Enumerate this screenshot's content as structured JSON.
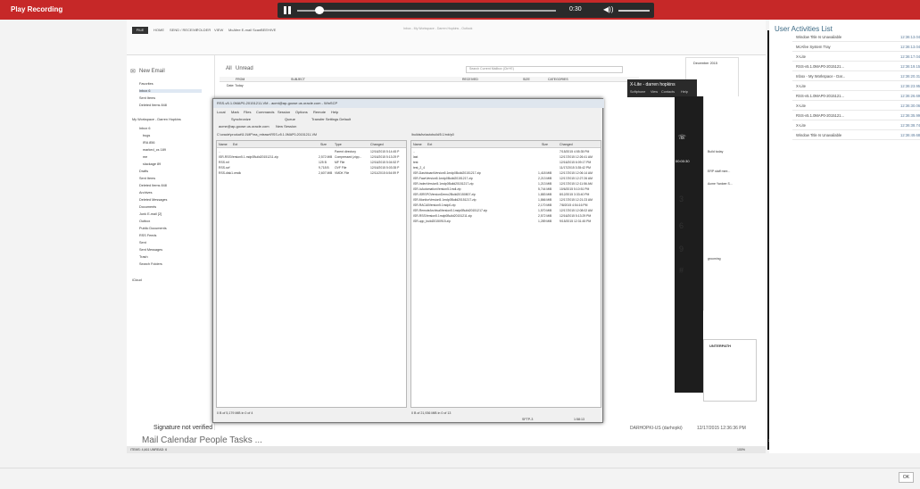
{
  "recording": {
    "title": "Play Recording",
    "time": "0:30",
    "progress": 0.04
  },
  "outlook": {
    "tabs": [
      "FILE",
      "HOME",
      "SEND / RECEIVE",
      "FOLDER",
      "VIEW",
      "McAfee E-mail Scan",
      "BEEHIVE"
    ],
    "title": "Inbox - My Workspace - Darren Hopkins - Outlook",
    "new_email": "New Email",
    "filter_all": "All",
    "filter_unread": "Unread",
    "search_placeholder": "Search Current Mailbox (Ctrl+E)",
    "folders": [
      "Favorites",
      "Inbox 6",
      "Sent Items",
      "Deleted Items 848",
      "My Workspace - Darren Hopkins",
      "Inbox 6",
      "bugs",
      "IRA 856",
      "marked_cs 189",
      "me",
      "slackage 89",
      "Drafts",
      "Sent Items",
      "Deleted Items 848",
      "Archives",
      "Deleted Messages",
      "Documents",
      "Junk E-mail [2]",
      "Outbox",
      "Public Documents",
      "RSS Feeds",
      "Sent",
      "Sent Messages",
      "Trash",
      "Search Folders",
      "iCloud"
    ],
    "columns": [
      "FROM",
      "SUBJECT",
      "RECEIVED",
      "SIZE",
      "CATEGORIES"
    ],
    "date_group": "Date: Today",
    "signature": "Signature not verified",
    "nav": [
      "Mail",
      "Calendar",
      "People",
      "Tasks",
      "..."
    ],
    "status": "ITEMS: 4,461   UNREAD: 6",
    "zoom": "100%"
  },
  "winscp": {
    "title": "RSS-v5.1.0MAP0-20151211-VM - acmt@ap-goose.us.oracle.com - WinSCP",
    "menu": [
      "Local",
      "Mark",
      "Files",
      "Commands",
      "Session",
      "Options",
      "Remote",
      "Help"
    ],
    "toolbar": [
      "Synchronize",
      "Queue",
      "Transfer Settings Default"
    ],
    "session_tab": "acme@ap-goose.us.oracle.com",
    "new_session": "New Session",
    "left": {
      "drive": "C: System",
      "path": "C:\\oracle\\product\\5.1\\MP\\rss_release\\RSS-v5.1.0MAP0-20151211-VM",
      "headers": [
        "Name",
        "Ext",
        "Size",
        "Type",
        "Changed"
      ],
      "rows": [
        {
          "name": "..",
          "size": "",
          "type": "Parent directory",
          "changed": "12/16/2015 5:14:45 P"
        },
        {
          "name": "ISR-RSSVersion5.1.mdp0Build20151211.zip",
          "size": "2,572 MiB",
          "type": "Compressed (zipp...",
          "changed": "12/16/2015 5:13:29 P"
        },
        {
          "name": "RSS.mf",
          "size": "125 B",
          "type": "MF File",
          "changed": "12/16/2015 5:04:52 P"
        },
        {
          "name": "RSS.ovf",
          "size": "9,718 B",
          "type": "OVF File",
          "changed": "12/16/2015 5:03:35 P"
        },
        {
          "name": "RSS-disk1.vmdk",
          "size": "2,607 MiB",
          "type": "VMDK File",
          "changed": "12/11/2015 6:54:59 P"
        }
      ],
      "status": "0 B of 5,179 MiB in 0 of 4"
    },
    "right": {
      "drive": "p0",
      "path": "/builds/isr/autobuild/5.1/mb/p0",
      "find": "Find Files",
      "headers": [
        "Name",
        "Ext",
        "Size",
        "Changed"
      ],
      "rows": [
        {
          "name": "..",
          "size": "",
          "changed": "7/15/2015 4:55:35 PM"
        },
        {
          "name": "last",
          "size": "",
          "changed": "12/17/2015 12:26:41 AM"
        },
        {
          "name": "test",
          "size": "",
          "changed": "12/16/2015 6:09:17 PM"
        },
        {
          "name": "test_2_4",
          "size": "",
          "changed": "11/17/2015 3:35:42 PM"
        },
        {
          "name": "ISR-DashboardVersion5.1mdp0Build20151217.zip",
          "size": "1,418 MiB",
          "changed": "12/17/2015 12:06:14 AM"
        },
        {
          "name": "ISR-FaceVersion5.1mdp0Build20151217.zip",
          "size": "2,213 MiB",
          "changed": "12/17/2015 12:27:26 AM"
        },
        {
          "name": "ISR-IndexVersion5.1mdp0Build20151217.zip",
          "size": "1,213 MiB",
          "changed": "12/17/2015 12:11:56 AM"
        },
        {
          "name": "ISR-IoAutomationVersion5.1mdl.zip",
          "size": "5,744 MiB",
          "changed": "10/6/2015 5:10:51 PM"
        },
        {
          "name": "ISR-ISRSPOVersionDemo2Build20150807.zip",
          "size": "1,883 MiB",
          "changed": "8/12/2015 3:33:40 PM"
        },
        {
          "name": "ISR-MonitorVersion5.1mdp0Build20151217.zip",
          "size": "1,866 MiB",
          "changed": "12/17/2015 12:21:23 AM"
        },
        {
          "name": "ISR-RACAllVersion5.1mdp0.zip",
          "size": "2,170 MiB",
          "changed": "7/8/2015 4:54:16 PM"
        },
        {
          "name": "ISR-RemoteArchivalVersion5.1mdp0Build20151217.zip",
          "size": "1,570 MiB",
          "changed": "12/17/2015 12:08:02 AM"
        },
        {
          "name": "ISR-RSSVersion5.1mdp0Build20151211.zip",
          "size": "2,572 MiB",
          "changed": "12/16/2015 5:13:29 PM"
        },
        {
          "name": "ISR-upp_build20150915.zip",
          "size": "1,289 MiB",
          "changed": "9/15/2015 12:31:45 PM"
        }
      ],
      "status": "0 B of 21,936 MiB in 0 of 13",
      "sftp": "SFTP-3",
      "elapsed": "1:58:13"
    }
  },
  "xlite": {
    "title": "X-Lite - darren hopkins",
    "menu": [
      "Softphone",
      "View",
      "Contacts",
      "Help"
    ],
    "timer": "00:00:30"
  },
  "calendar": {
    "month": "December 2015",
    "days": [
      "3",
      "6",
      "9",
      "#"
    ]
  },
  "people_pane": {
    "items": [
      "Build today",
      "ERP staff mee...",
      "Acme Yankee S...",
      "grooming"
    ],
    "brand": "UNTERPATH"
  },
  "user_activities": {
    "title": "User Activities List",
    "rows": [
      {
        "name": "Window Title Is Unavailable",
        "time": "12:36:13.043"
      },
      {
        "name": "McAfee System Tray",
        "time": "12:36:13.043"
      },
      {
        "name": "X-Lite",
        "time": "12:36:17.040"
      },
      {
        "name": "RSS-v5.1.0MAP0-2015121...",
        "time": "12:36:19.150"
      },
      {
        "name": "Inbox - My Workspace - Dar...",
        "time": "12:36:20.313"
      },
      {
        "name": "X-Lite",
        "time": "12:36:23.953"
      },
      {
        "name": "RSS-v5.1.0MAP0-2015121...",
        "time": "12:36:26.690"
      },
      {
        "name": "X-Lite",
        "time": "12:36:30.060"
      },
      {
        "name": "RSS-v5.1.0MAP0-2015121...",
        "time": "12:36:35.990"
      },
      {
        "name": "X-Lite",
        "time": "12:36:38.740"
      },
      {
        "name": "Window Title Is Unavailable",
        "time": "12:36:49.687"
      }
    ]
  },
  "taskbar_status": {
    "user": "DARHOPKI-US (darhopki)",
    "date": "12/17/2015 12:36:36 PM",
    "clock": "12:36 PM",
    "date_short": "12/17/2015"
  },
  "ok_label": "OK"
}
